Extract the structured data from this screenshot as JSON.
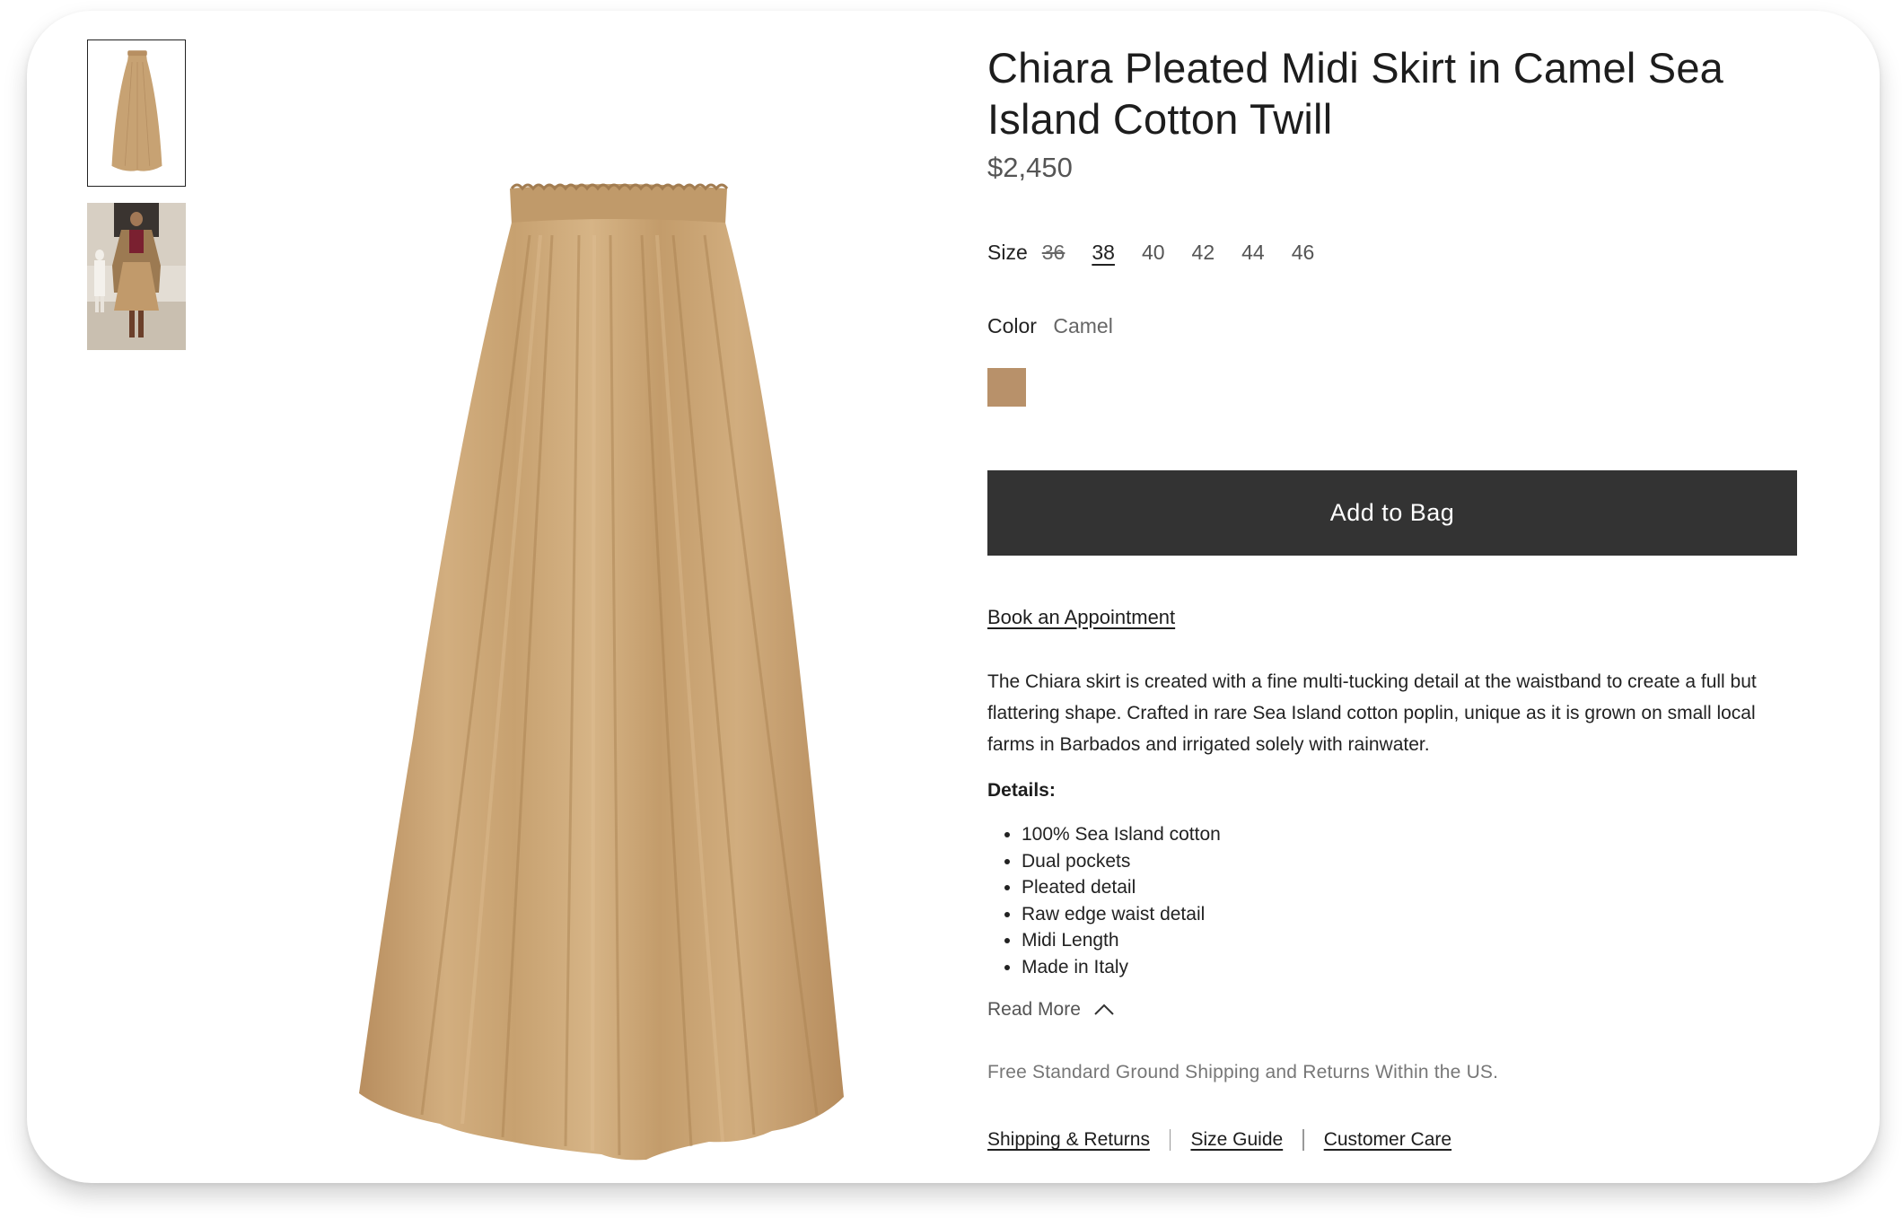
{
  "product": {
    "title": "Chiara Pleated Midi Skirt in Camel Sea Island Cotton Twill",
    "price": "$2,450"
  },
  "size": {
    "label": "Size",
    "options": [
      {
        "label": "36",
        "available": false,
        "selected": false
      },
      {
        "label": "38",
        "available": true,
        "selected": true
      },
      {
        "label": "40",
        "available": true,
        "selected": false
      },
      {
        "label": "42",
        "available": true,
        "selected": false
      },
      {
        "label": "44",
        "available": true,
        "selected": false
      },
      {
        "label": "46",
        "available": true,
        "selected": false
      }
    ]
  },
  "color": {
    "label": "Color",
    "value": "Camel",
    "swatch_hex": "#b8916a"
  },
  "actions": {
    "add_to_bag": "Add to Bag",
    "book_appointment": "Book an Appointment"
  },
  "description": "The Chiara skirt is created with a fine multi-tucking detail at the waistband to create a full but flattering shape. Crafted in rare Sea Island cotton poplin, unique as it is grown on small local farms in Barbados and irrigated solely with rainwater.",
  "details": {
    "heading": "Details:",
    "items": [
      "100% Sea Island cotton",
      "Dual pockets",
      "Pleated detail",
      "Raw edge waist detail",
      "Midi Length",
      "Made in Italy"
    ]
  },
  "read_more": "Read More",
  "shipping_note": "Free Standard Ground Shipping and Returns Within the US.",
  "footer_links": [
    "Shipping & Returns",
    "Size Guide",
    "Customer Care"
  ],
  "icons": {
    "read_more": "chevron-up-icon"
  },
  "colors": {
    "button_bg": "#333333",
    "skirt": "#c9a475"
  }
}
